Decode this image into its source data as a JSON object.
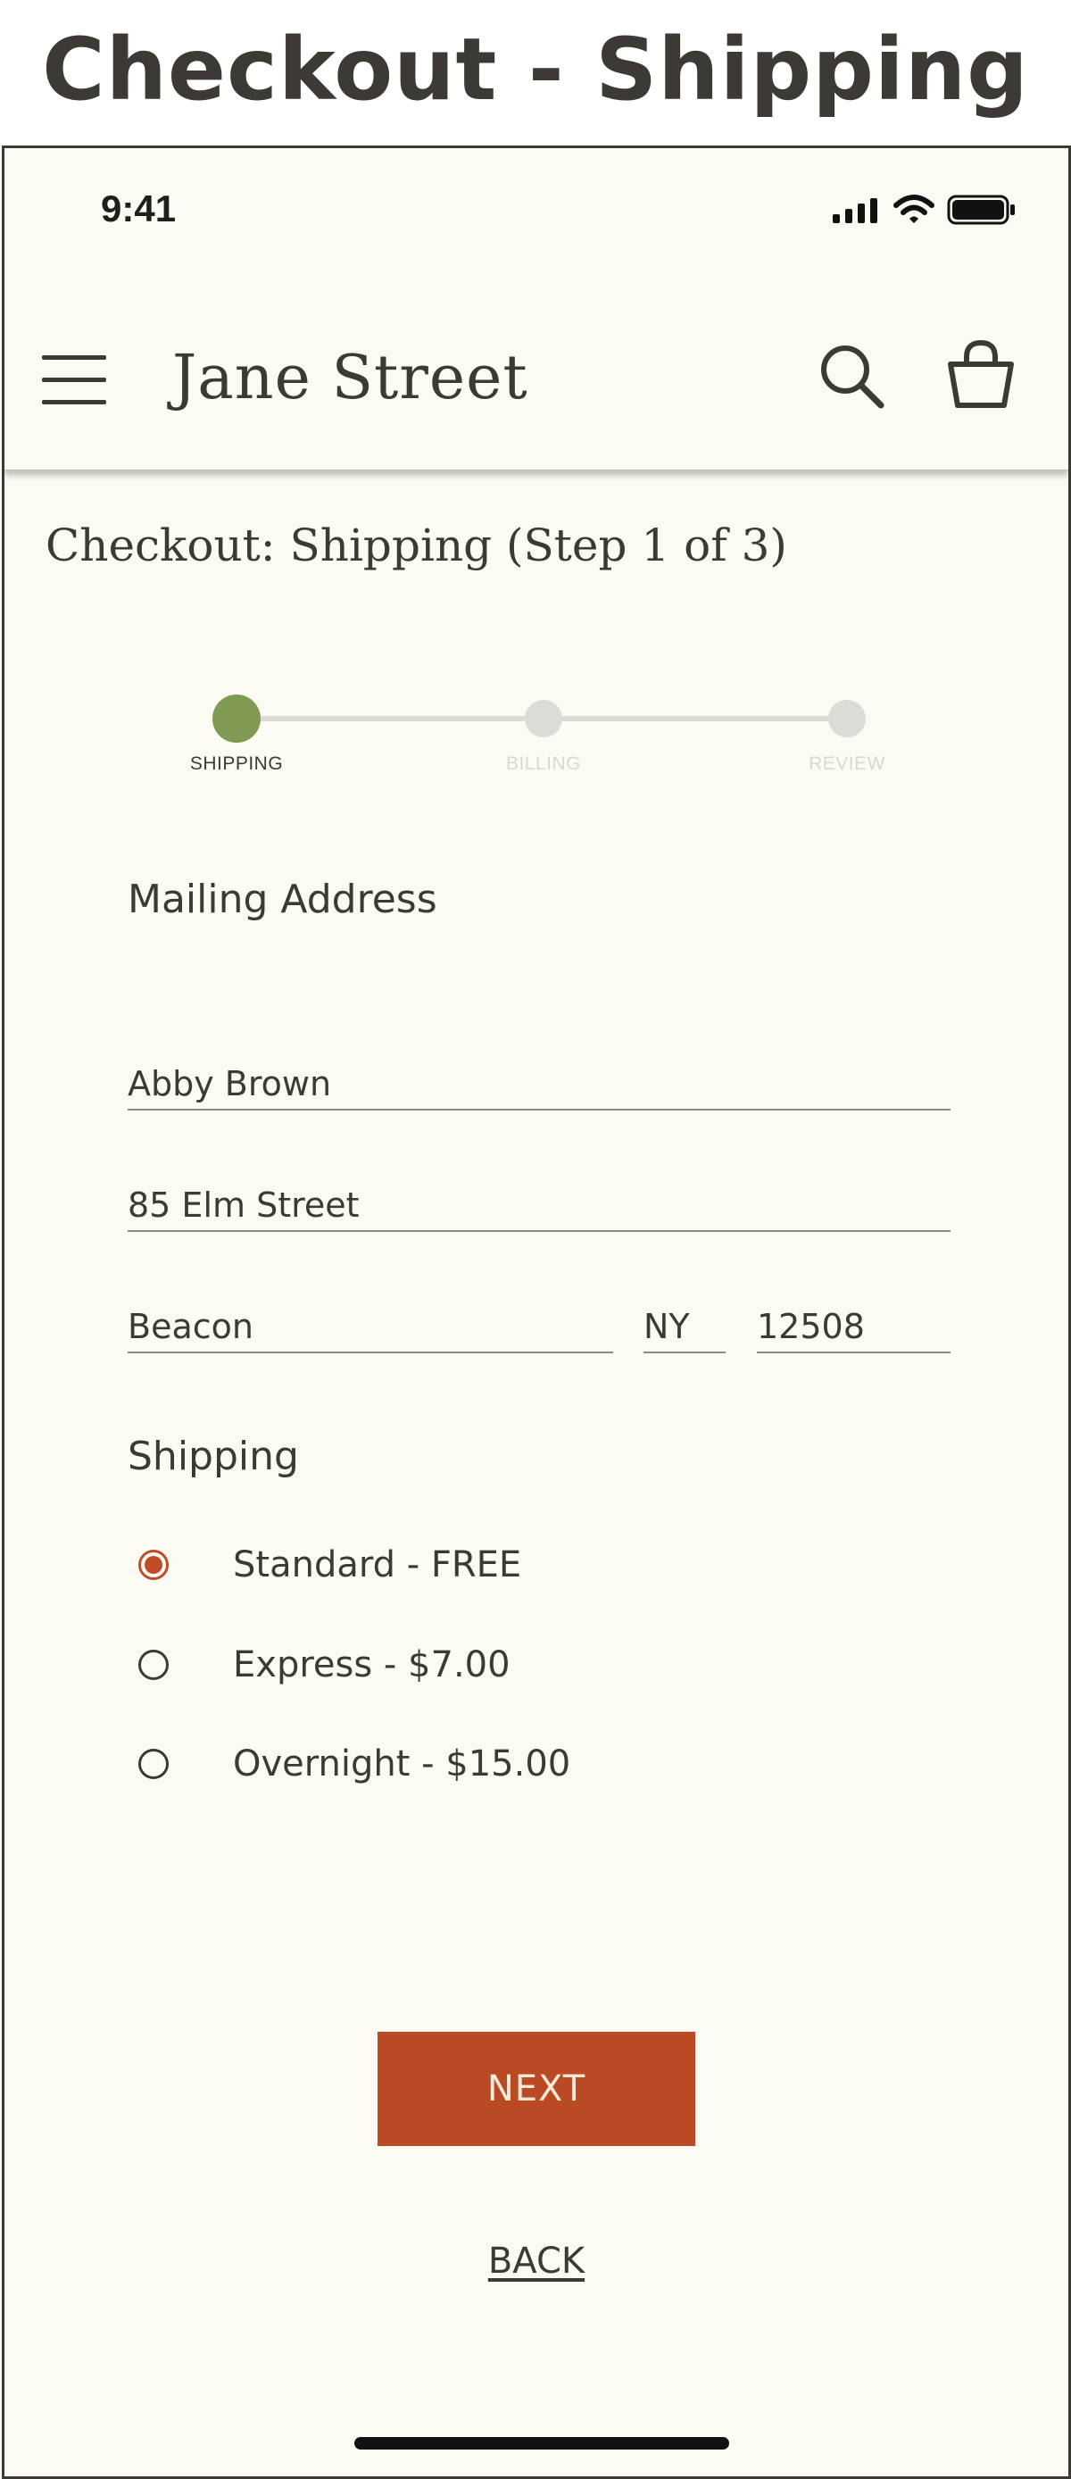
{
  "page_heading": "Checkout - Shipping",
  "status_bar": {
    "time": "9:41",
    "icons": [
      "cellular-signal-icon",
      "wifi-icon",
      "battery-icon"
    ]
  },
  "header": {
    "brand": "Jane Street",
    "icons": [
      "menu-icon",
      "search-icon",
      "shopping-bag-icon"
    ]
  },
  "page_title": "Checkout: Shipping (Step 1 of 3)",
  "stepper": {
    "steps": [
      {
        "label": "SHIPPING",
        "state": "active"
      },
      {
        "label": "BILLING",
        "state": "inactive"
      },
      {
        "label": "REVIEW",
        "state": "inactive"
      }
    ]
  },
  "mailing_address": {
    "title": "Mailing Address",
    "name": "Abby Brown",
    "street": "85 Elm Street",
    "city": "Beacon",
    "state": "NY",
    "zip": "12508"
  },
  "shipping": {
    "title": "Shipping",
    "options": [
      {
        "label": "Standard - FREE",
        "selected": true
      },
      {
        "label": "Express - $7.00",
        "selected": false
      },
      {
        "label": "Overnight - $15.00",
        "selected": false
      }
    ]
  },
  "actions": {
    "next_label": "NEXT",
    "back_label": "BACK"
  },
  "colors": {
    "accent": "#b94a24",
    "step_active": "#7f9a52",
    "step_inactive": "#dcdcd6",
    "background": "#fbfbf4",
    "text": "#3d3a36"
  }
}
